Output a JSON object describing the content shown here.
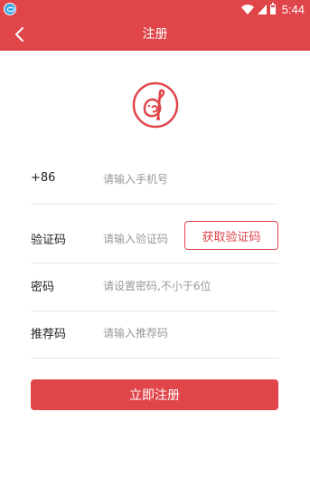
{
  "status_bar": {
    "time": "5:44",
    "app_icon": "app-notification-icon",
    "icons": [
      "wifi-icon",
      "signal-icon",
      "battery-icon"
    ]
  },
  "header": {
    "title": "注册",
    "back_icon": "chevron-left-icon"
  },
  "logo": {
    "icon": "treble-clef-bird-logo"
  },
  "form": {
    "phone": {
      "label": "+86",
      "placeholder": "请输入手机号"
    },
    "code": {
      "label": "验证码",
      "placeholder": "请输入验证码",
      "button_label": "获取验证码"
    },
    "password": {
      "label": "密码",
      "placeholder": "请设置密码,不小于6位"
    },
    "referrer": {
      "label": "推荐码",
      "placeholder": "请输入推荐码"
    }
  },
  "submit": {
    "label": "立即注册"
  },
  "colors": {
    "brand": "#e0454a",
    "divider": "#e6e6e6",
    "placeholder": "#999999"
  }
}
